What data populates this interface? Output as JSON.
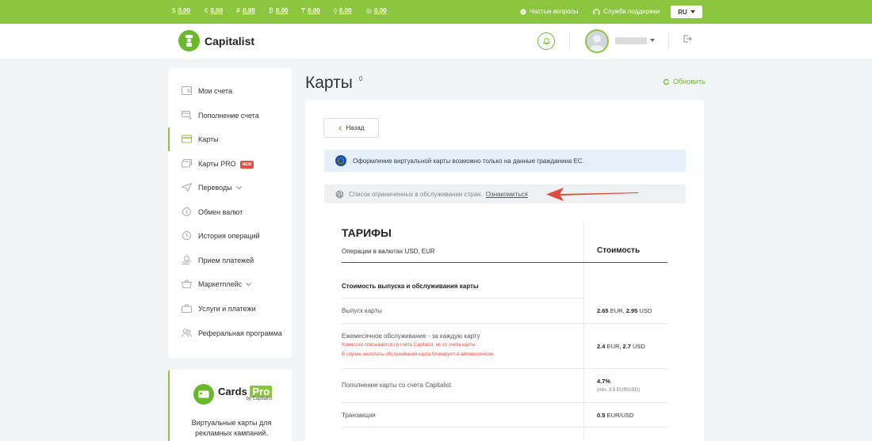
{
  "topbar": {
    "currencies": [
      {
        "symbol": "$",
        "value": "0,00"
      },
      {
        "symbol": "€",
        "value": "0,00"
      },
      {
        "symbol": "₽",
        "value": "0,00"
      },
      {
        "symbol": "₿",
        "value": "0,00"
      },
      {
        "symbol": "₸",
        "value": "0,00"
      },
      {
        "symbol": "⟠",
        "value": "0,00"
      },
      {
        "symbol": "◎",
        "value": "0,00"
      }
    ],
    "faq": "Частые вопросы",
    "support": "Служба поддержки",
    "language": "RU"
  },
  "header": {
    "brand": "Capitalist"
  },
  "sidebar": {
    "items": [
      {
        "label": "Мои счета"
      },
      {
        "label": "Пополнение счета"
      },
      {
        "label": "Карты"
      },
      {
        "label": "Карты PRO",
        "badge": "NEW"
      },
      {
        "label": "Переводы"
      },
      {
        "label": "Обмен валют"
      },
      {
        "label": "История операций"
      },
      {
        "label": "Прием платежей"
      },
      {
        "label": "Маркетплейс"
      },
      {
        "label": "Услуги и платежи"
      },
      {
        "label": "Реферальная программа"
      }
    ]
  },
  "promo": {
    "brand": "Cards",
    "brand_pro": "Pro",
    "sub": "by Capitalist",
    "text_line1": "Виртуальные карты для",
    "text_line2": "рекламных кампаний."
  },
  "page": {
    "title": "Карты",
    "count": "0",
    "refresh": "Обновить"
  },
  "content": {
    "back": "Назад",
    "info": "Оформление виртуальной карты возможно только на данные гражданина ЕС.",
    "restrict": "Список ограниченных в обслуживании стран.",
    "restrict_link": "Ознакомиться",
    "tariffs": {
      "title": "ТАРИФЫ",
      "subtitle": "Операции в валютах USD, EUR",
      "cost_header": "Стоимость",
      "section": "Стоимость выпуска и обслуживания карты",
      "rows": [
        {
          "label": "Выпуск карты",
          "v1": "2.65",
          "c1": " EUR, ",
          "v2": "2.95",
          "c2": " USD"
        },
        {
          "label": "Ежемесячное обслуживание - за каждую карту",
          "note1": "Комиссия списывается со счета Capitalist, не со счета карты.",
          "note2": "В случае неоплаты обслуживания карта блокируется автоматически.",
          "v1": "2.4",
          "c1": " EUR, ",
          "v2": "2.7",
          "c2": " USD"
        },
        {
          "label": "Пополнение карты со счета Capitalist",
          "v1": "4.7%",
          "small": "(min. 3.5 EUR/USD)"
        },
        {
          "label": "Транзакция",
          "v1": "0.5",
          "c1": " EUR/USD"
        }
      ]
    }
  },
  "colors": {
    "brand_green": "#8cc63f",
    "accent_red": "#e74c3c",
    "info_bg": "#e6f0fb"
  }
}
